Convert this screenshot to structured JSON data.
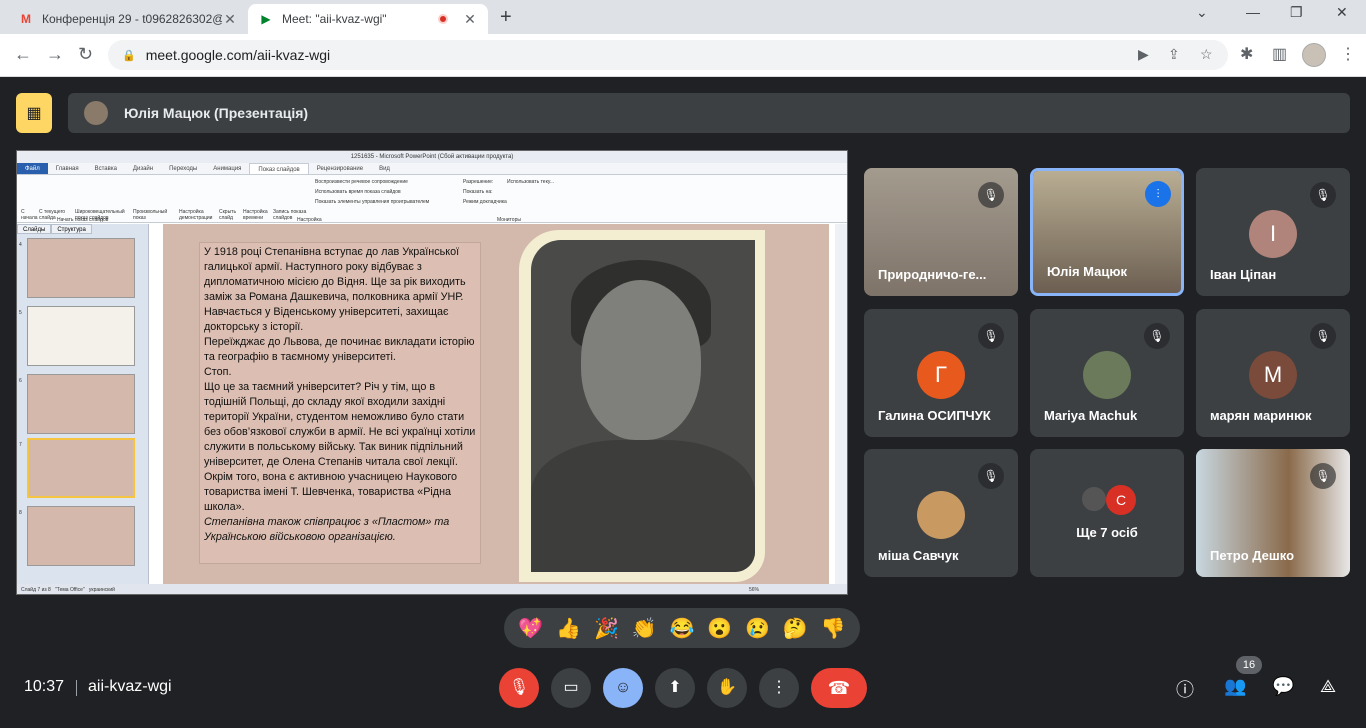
{
  "browser": {
    "tabs": [
      {
        "title": "Конференція 29 - t0962826302@",
        "icon": "gmail-icon"
      },
      {
        "title": "Meet: \"aii-kvaz-wgi\"",
        "icon": "meet-icon",
        "recording": true
      }
    ],
    "url": "meet.google.com/aii-kvaz-wgi"
  },
  "presenter_bar": {
    "text": "Юлія Мацюк (Презентація)"
  },
  "ppt": {
    "window_title": "1251635 - Microsoft PowerPoint (Сбой активации продукта)",
    "ribbon_tabs": [
      "Файл",
      "Главная",
      "Вставка",
      "Дизайн",
      "Переходы",
      "Анимация",
      "Показ слайдов",
      "Рецензирование",
      "Вид"
    ],
    "ribbon_labels": [
      "С начала",
      "С текущего слайда",
      "Широковещательный показ слайдов",
      "Произвольный показ",
      "Настройка демонстрации",
      "Скрыть слайд",
      "Настройка времени",
      "Запись показа слайдов",
      "Воспроизвести речевое сопровождение",
      "Использовать время показа слайдов",
      "Показать элементы управления проигрывателем",
      "Разрешение:",
      "Использовать теку...",
      "Показать на:",
      "Режим докладчика",
      "Начать показ слайдов",
      "Настройка",
      "Мониторы"
    ],
    "thumb_tabs": [
      "Слайды",
      "Структура"
    ],
    "thumb_numbers": [
      "4",
      "5",
      "6",
      "7",
      "8"
    ],
    "status_left": "Слайд 7 из 8",
    "status_theme": "\"Тема Office\"",
    "status_lang": "украинский",
    "zoom": "56%"
  },
  "slide": {
    "paragraphs": [
      "У 1918 році Степанівна вступає до лав Української галицької армії. Наступного року відбуває з дипломатичною місією до Відня. Ще за рік виходить заміж за Романа Дашкевича, полковника армії УНР. Навчається у Віденському університеті, захищає докторську з історії.",
      "Переїжджає до Львова, де починає викладати історію та географію в таємному університеті.",
      "Стоп.",
      " Що це за таємний університет? Річ у тім, що в тодішній Польщі, до складу якої входили західні території України, студентом неможливо було стати без обов’язкової служби в армії. Не всі українці хотіли служити в польському війську. Так виник підпільний університет, де Олена Степанів читала свої лекції.",
      "Окрім того, вона є активною учасницею Наукового товариства імені Т. Шевченка, товариства «Рідна школа»."
    ],
    "italic": "Степанівна також співпрацює з «Пластом» та Українською військовою організацією."
  },
  "participants": [
    {
      "name": "Природничо-ге...",
      "type": "video"
    },
    {
      "name": "Юлія Мацюк",
      "type": "video",
      "speaking": true
    },
    {
      "name": "Іван Ціпан",
      "initial": "І",
      "color": "#b0847a"
    },
    {
      "name": "Галина ОСИПЧУК",
      "initial": "Г",
      "color": "#e8591e"
    },
    {
      "name": "Mariya Machuk",
      "type": "photo"
    },
    {
      "name": "марян маринюк",
      "initial": "М",
      "color": "#7a4a3a"
    },
    {
      "name": "міша Савчук",
      "type": "photo"
    },
    {
      "name": "Ще 7 осіб",
      "initial": "С",
      "color": "#d93025"
    },
    {
      "name": "Петро Дешко",
      "type": "video"
    }
  ],
  "reactions": [
    "💖",
    "👍",
    "🎉",
    "👏",
    "😂",
    "😮",
    "😢",
    "🤔",
    "👎"
  ],
  "footer": {
    "time": "10:37",
    "meeting_code": "aii-kvaz-wgi",
    "participant_count": "16"
  },
  "colors": {
    "end_call": "#ea4335",
    "mic_off": "#ea4335",
    "reactions_active": "#8ab4f8",
    "presenter_badge": "#fdd663"
  }
}
